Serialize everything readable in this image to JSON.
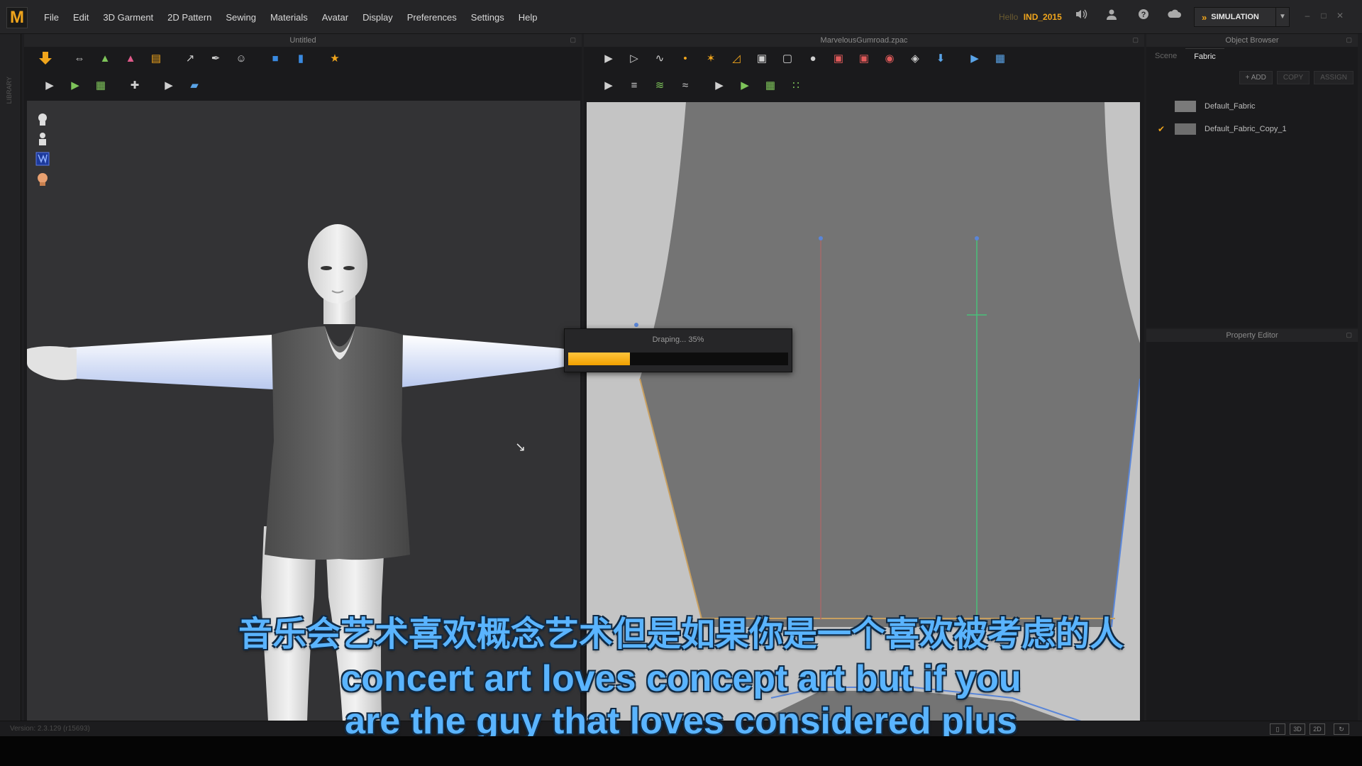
{
  "app": {
    "logo_letter": "M"
  },
  "menu": [
    "File",
    "Edit",
    "3D Garment",
    "2D Pattern",
    "Sewing",
    "Materials",
    "Avatar",
    "Display",
    "Preferences",
    "Settings",
    "Help"
  ],
  "user": {
    "hello": "Hello",
    "name": "IND_2015"
  },
  "mode": {
    "label": "SIMULATION"
  },
  "left_strip": {
    "label": "LIBRARY"
  },
  "panels": {
    "view3d_title": "Untitled",
    "view2d_title": "MarvelousGumroad.zpac",
    "object_browser_title": "Object Browser",
    "property_editor_title": "Property Editor"
  },
  "object_browser": {
    "tabs": [
      "Scene",
      "Fabric"
    ],
    "active_tab": "Fabric",
    "buttons": {
      "add": "+ ADD",
      "copy": "COPY",
      "assign": "ASSIGN"
    },
    "fabrics": [
      {
        "name": "Default_Fabric",
        "selected": false,
        "swatch": "#7a7a7a"
      },
      {
        "name": "Default_Fabric_Copy_1",
        "selected": true,
        "swatch": "#6e6e6e"
      }
    ]
  },
  "progress": {
    "label": "Draping... 35%",
    "fraction": 0.28
  },
  "status": {
    "version": "Version: 2.3.129   (r15693)"
  },
  "subtitles": {
    "zh": "音乐会艺术喜欢概念艺术但是如果你是一个喜欢被考虑的人",
    "en_line1": "concert art loves concept art but if you",
    "en_line2": "are the guy that loves considered plus"
  },
  "colors": {
    "accent": "#f0a51c",
    "subtitle": "#5ab4ff",
    "viewport_3d": "#333335",
    "viewport_2d": "#c4c4c4"
  },
  "icons": {
    "top": [
      "speaker-icon",
      "user-icon",
      "help-icon",
      "cloud-icon"
    ],
    "view3d_side": [
      "avatar-head-icon",
      "avatar-body-icon",
      "texture-icon",
      "skin-icon"
    ]
  }
}
